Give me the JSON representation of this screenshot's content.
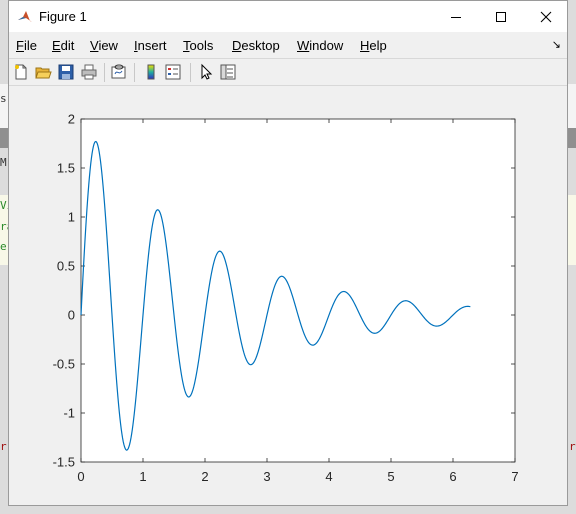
{
  "window": {
    "title": "Figure 1",
    "minimize_glyph": "—",
    "maximize_glyph": "☐",
    "close_glyph": "✕"
  },
  "menu": {
    "items": [
      {
        "label": "File",
        "mnemonic": "F",
        "rest": "ile"
      },
      {
        "label": "Edit",
        "mnemonic": "E",
        "rest": "dit"
      },
      {
        "label": "View",
        "mnemonic": "V",
        "rest": "iew"
      },
      {
        "label": "Insert",
        "mnemonic": "I",
        "rest": "nsert"
      },
      {
        "label": "Tools",
        "mnemonic": "T",
        "rest": "ools"
      },
      {
        "label": "Desktop",
        "mnemonic": "D",
        "rest": "esktop"
      },
      {
        "label": "Window",
        "mnemonic": "W",
        "rest": "indow"
      },
      {
        "label": "Help",
        "mnemonic": "H",
        "rest": "elp"
      }
    ],
    "dock_glyph": "↘"
  },
  "toolbar": {
    "buttons": [
      "new-figure-icon",
      "open-file-icon",
      "save-icon",
      "print-icon",
      "link-plot-icon",
      "colorbar-icon",
      "legend-icon",
      "edit-plot-arrow-icon",
      "property-inspector-icon"
    ]
  },
  "background": {
    "left_fragments": [
      "s",
      "M",
      "Vi",
      "ra",
      "e",
      "r"
    ],
    "right_fragments": [
      "r"
    ]
  },
  "chart_data": {
    "type": "line",
    "title": "",
    "xlabel": "",
    "ylabel": "",
    "xlim": [
      0,
      7
    ],
    "ylim": [
      -1.5,
      2
    ],
    "xticks": [
      "0",
      "1",
      "2",
      "3",
      "4",
      "5",
      "6",
      "7"
    ],
    "yticks": [
      "2",
      "1.5",
      "1",
      "0.5",
      "0",
      "-0.5",
      "-1",
      "-1.5"
    ],
    "grid": false,
    "series": [
      {
        "color": "#0072bd",
        "function": "2*exp(-t/2)*sin(2*pi*t)",
        "x": [
          0,
          0.25,
          0.75,
          1.25,
          1.75,
          2.25,
          2.75,
          3.25,
          3.75,
          4.25,
          4.75,
          5.25,
          5.75,
          6.28
        ],
        "y": [
          0,
          1.76,
          -1.37,
          1.07,
          -0.83,
          0.65,
          -0.5,
          0.39,
          -0.31,
          0.24,
          -0.19,
          0.15,
          -0.11,
          0.09
        ]
      }
    ]
  }
}
